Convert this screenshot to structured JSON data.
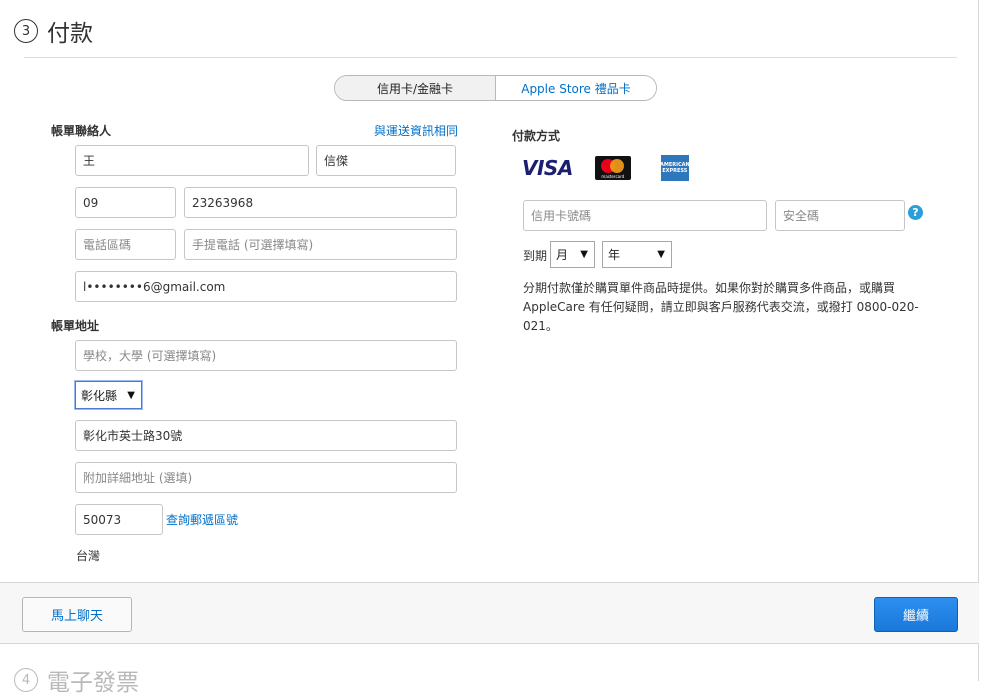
{
  "step": {
    "number": "3",
    "title": "付款"
  },
  "next_step": {
    "number": "4",
    "title": "電子發票"
  },
  "payment_tabs": [
    {
      "label": "信用卡/金融卡",
      "active": true
    },
    {
      "label": "Apple Store 禮品卡",
      "active": false
    }
  ],
  "billing_contact": {
    "label": "帳單聯絡人",
    "same_as_shipping_link": "與運送資訊相同",
    "last_name": "王",
    "first_name": "信傑",
    "area_code": "09",
    "phone": "23263968",
    "mobile_area_placeholder": "電話區碼",
    "mobile_placeholder": "手提電話 (可選擇填寫)",
    "email": "l••••••••6@gmail.com"
  },
  "billing_address": {
    "label": "帳單地址",
    "school_placeholder": "學校，大學 (可選擇填寫)",
    "county": "彰化縣",
    "street": "彰化市英士路30號",
    "extra_placeholder": "附加詳細地址 (選填)",
    "postal_code": "50073",
    "postal_lookup_link": "查詢郵遞區號",
    "country": "台灣"
  },
  "payment_method": {
    "label": "付款方式",
    "card_brands": [
      "visa-icon",
      "mastercard-icon",
      "amex-icon"
    ],
    "visa_text": "VISA",
    "mastercard_text": "mastercard",
    "amex_text": "AMERICAN EXPRESS",
    "card_number_placeholder": "信用卡號碼",
    "cvv_placeholder": "安全碼",
    "help_glyph": "?",
    "expiry_label": "到期",
    "month_value": "月",
    "year_value": "年",
    "notice": "分期付款僅於購買單件商品時提供。如果你對於購買多件商品，或購買 AppleCare 有任何疑問，請立即與客戶服務代表交流，或撥打 0800-020-021。"
  },
  "footer": {
    "chat_button": "馬上聊天",
    "continue_button": "繼續"
  },
  "colors": {
    "link": "#0070c9",
    "primary_button": "#1a78d9",
    "help_icon": "#2aa0da"
  }
}
